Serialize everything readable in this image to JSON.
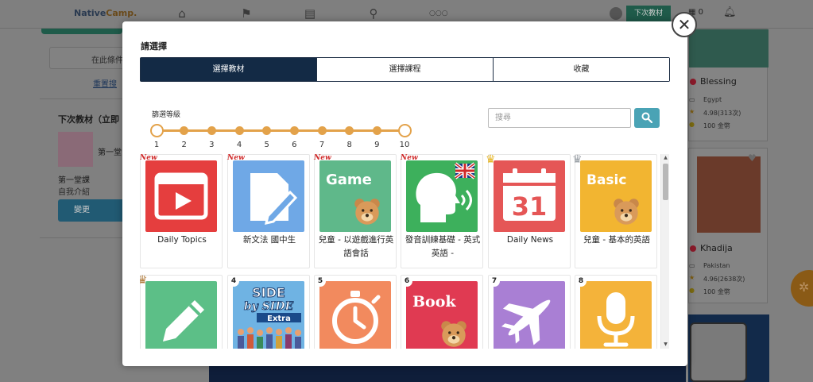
{
  "background": {
    "logo": {
      "part1": "Native",
      "part2": "Camp."
    },
    "nav_icons": [
      "home-icon",
      "flag-icon",
      "book-icon",
      "search-icon",
      "more-icon"
    ],
    "more_label": "○○○",
    "next_material_button": "下次教材",
    "coin_count": "0",
    "filter_box_text": "在此條件",
    "reset_link": "重置搜",
    "next_material_title": "下次教材（立即",
    "lesson_title_a": "第一堂",
    "lesson_title_b": "第一堂課",
    "lesson_subtitle": "自我介紹",
    "change_button": "變更",
    "teachers": [
      {
        "name": "Blessing",
        "country": "Egypt",
        "rating": "4.98(313次)",
        "coins": "100 金幣"
      },
      {
        "name": "Khadija",
        "country": "Pakistan",
        "rating": "4.96(2638次)",
        "coins": "100 金幣"
      }
    ]
  },
  "modal": {
    "title": "請選擇",
    "tabs": [
      {
        "label": "選擇教材",
        "active": true
      },
      {
        "label": "選擇課程",
        "active": false
      },
      {
        "label": "收藏",
        "active": false
      }
    ],
    "filter_label": "篩選等級",
    "levels": [
      "1",
      "2",
      "3",
      "4",
      "5",
      "6",
      "7",
      "8",
      "9",
      "10"
    ],
    "level_range": {
      "min": 1,
      "max": 10
    },
    "search": {
      "placeholder": "搜尋",
      "value": ""
    },
    "materials": [
      {
        "label": "Daily Topics",
        "badge": "New",
        "icon": "video-play-icon",
        "color": "#e53e3e"
      },
      {
        "label": "新文法 國中生",
        "badge": "New",
        "icon": "document-pen-icon",
        "color": "#6fa8e6"
      },
      {
        "label": "兒童 - 以遊戲進行英語會話",
        "badge": "New",
        "icon": "game-bear-icon",
        "thumb_text": "Game",
        "color": "#5fb88a"
      },
      {
        "label": "發音訓練基礎 - 英式英語 -",
        "badge": "New",
        "icon": "speaking-head-icon",
        "color": "#3db05c"
      },
      {
        "label": "Daily News",
        "badge": "crown-gold-icon",
        "icon": "calendar-icon",
        "thumb_text": "31",
        "color": "#e55656"
      },
      {
        "label": "兒童 - 基本的英語",
        "badge": "crown-silver-icon",
        "icon": "basic-bear-icon",
        "thumb_text": "Basic",
        "color": "#f2b531"
      },
      {
        "label": "",
        "badge": "crown-bronze-icon",
        "icon": "pencil-icon",
        "color": "#5cbf87"
      },
      {
        "label": "",
        "badge": "4",
        "icon": "side-by-side-book-icon",
        "thumb_text": "SIDE by SIDE",
        "thumb_sub": "Extra",
        "color": "#4a9ad8"
      },
      {
        "label": "",
        "badge": "5",
        "icon": "stopwatch-icon",
        "color": "#f28a5e"
      },
      {
        "label": "",
        "badge": "6",
        "icon": "book-bear-icon",
        "thumb_text": "Book",
        "color": "#e03a52"
      },
      {
        "label": "",
        "badge": "7",
        "icon": "airplane-icon",
        "color": "#a97fd4"
      },
      {
        "label": "",
        "badge": "8",
        "icon": "microphone-icon",
        "color": "#f4b33a"
      }
    ]
  }
}
